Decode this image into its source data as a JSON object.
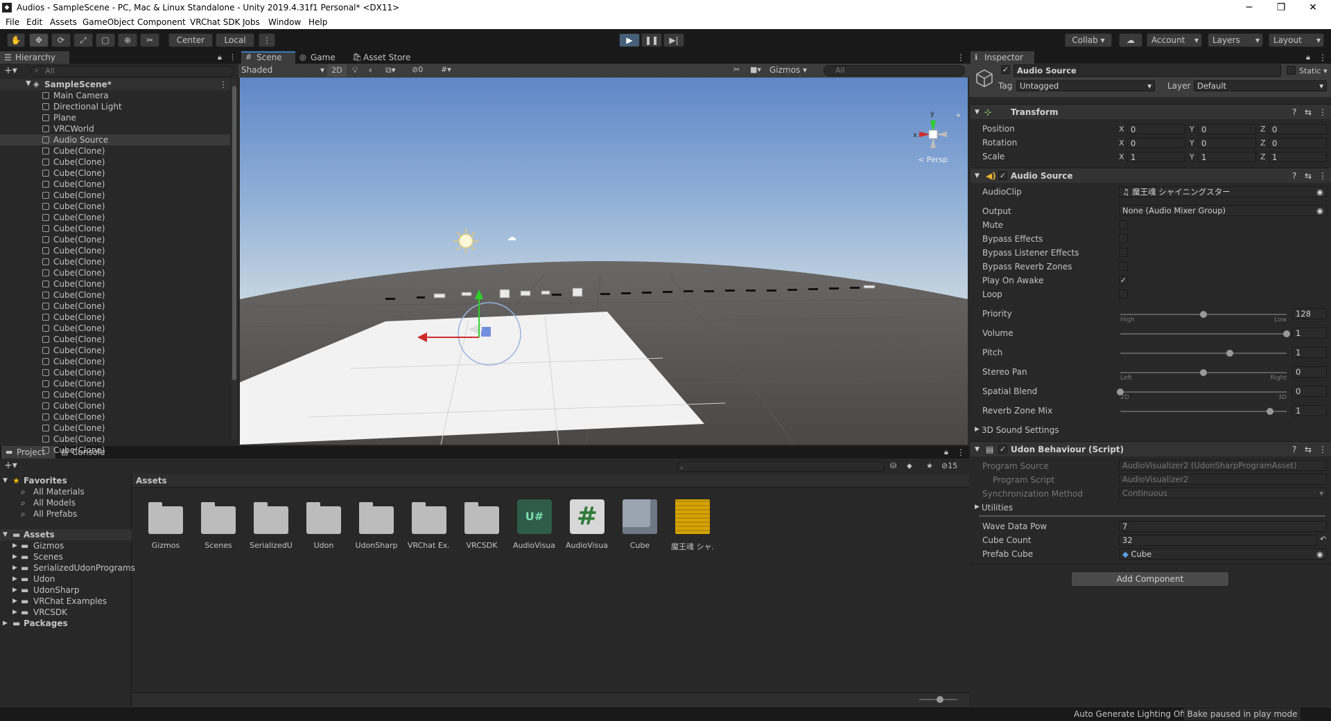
{
  "window": {
    "title": "Audios - SampleScene - PC, Mac & Linux Standalone - Unity 2019.4.31f1 Personal* <DX11>",
    "minimize": "─",
    "maximize": "❐",
    "close": "✕"
  },
  "menu": [
    "File",
    "Edit",
    "Assets",
    "GameObject",
    "Component",
    "VRChat SDK",
    "Jobs",
    "Window",
    "Help"
  ],
  "toolbar": {
    "center": "Center",
    "local": "Local",
    "collab": "Collab",
    "account": "Account",
    "layers": "Layers",
    "layout": "Layout"
  },
  "hierarchy": {
    "tab": "Hierarchy",
    "search_placeholder": "All",
    "scene": "SampleScene*",
    "items": [
      "Main Camera",
      "Directional Light",
      "Plane",
      "VRCWorld",
      "Audio Source",
      "Cube(Clone)",
      "Cube(Clone)",
      "Cube(Clone)",
      "Cube(Clone)",
      "Cube(Clone)",
      "Cube(Clone)",
      "Cube(Clone)",
      "Cube(Clone)",
      "Cube(Clone)",
      "Cube(Clone)",
      "Cube(Clone)",
      "Cube(Clone)",
      "Cube(Clone)",
      "Cube(Clone)",
      "Cube(Clone)",
      "Cube(Clone)",
      "Cube(Clone)",
      "Cube(Clone)",
      "Cube(Clone)",
      "Cube(Clone)",
      "Cube(Clone)",
      "Cube(Clone)",
      "Cube(Clone)",
      "Cube(Clone)",
      "Cube(Clone)",
      "Cube(Clone)",
      "Cube(Clone)",
      "Cube(Clone)"
    ],
    "selected": "Audio Source"
  },
  "scene": {
    "tabs": [
      "Scene",
      "Game",
      "Asset Store"
    ],
    "shading": "Shaded",
    "mode2d": "2D",
    "hidden_count": "0",
    "gizmos": "Gizmos",
    "search_placeholder": "All",
    "persp": "< Persp",
    "axis_x": "x",
    "axis_y": "y"
  },
  "project": {
    "tabs": [
      "Project",
      "Console"
    ],
    "breadcrumb": "Assets",
    "hidden_count": "15",
    "favorites": {
      "label": "Favorites",
      "items": [
        "All Materials",
        "All Models",
        "All Prefabs"
      ]
    },
    "assets": {
      "label": "Assets",
      "items": [
        "Gizmos",
        "Scenes",
        "SerializedUdonPrograms",
        "Udon",
        "UdonSharp",
        "VRChat Examples",
        "VRCSDK"
      ]
    },
    "packages": "Packages",
    "grid": [
      {
        "name": "Gizmos",
        "kind": "folder"
      },
      {
        "name": "Scenes",
        "kind": "folder"
      },
      {
        "name": "SerializedU...",
        "kind": "folder"
      },
      {
        "name": "Udon",
        "kind": "folder"
      },
      {
        "name": "UdonSharp",
        "kind": "folder"
      },
      {
        "name": "VRChat Ex...",
        "kind": "folder"
      },
      {
        "name": "VRCSDK",
        "kind": "folder"
      },
      {
        "name": "AudioVisual...",
        "kind": "udonsharp"
      },
      {
        "name": "AudioVisual...",
        "kind": "csharp"
      },
      {
        "name": "Cube",
        "kind": "prefab"
      },
      {
        "name": "魔王魂 シャ...",
        "kind": "audio"
      }
    ]
  },
  "inspector": {
    "tab": "Inspector",
    "object_name": "Audio Source",
    "static": "Static",
    "tag_label": "Tag",
    "tag": "Untagged",
    "layer_label": "Layer",
    "layer": "Default",
    "transform": {
      "title": "Transform",
      "position": {
        "label": "Position",
        "x": "0",
        "y": "0",
        "z": "0"
      },
      "rotation": {
        "label": "Rotation",
        "x": "0",
        "y": "0",
        "z": "0"
      },
      "scale": {
        "label": "Scale",
        "x": "1",
        "y": "1",
        "z": "1"
      }
    },
    "audio": {
      "title": "Audio Source",
      "clip_label": "AudioClip",
      "clip": "♫ 魔王魂 シャイニングスター",
      "output_label": "Output",
      "output": "None (Audio Mixer Group)",
      "mute": "Mute",
      "bypass_effects": "Bypass Effects",
      "bypass_listener": "Bypass Listener Effects",
      "bypass_reverb": "Bypass Reverb Zones",
      "play_on_awake": "Play On Awake",
      "loop": "Loop",
      "check": "✓",
      "priority": {
        "label": "Priority",
        "value": "128",
        "pos": 0.5,
        "min_label": "High",
        "max_label": "Low"
      },
      "volume": {
        "label": "Volume",
        "value": "1",
        "pos": 1.0
      },
      "pitch": {
        "label": "Pitch",
        "value": "1",
        "pos": 0.66
      },
      "stereo_pan": {
        "label": "Stereo Pan",
        "value": "0",
        "pos": 0.5,
        "min_label": "Left",
        "max_label": "Right"
      },
      "spatial_blend": {
        "label": "Spatial Blend",
        "value": "0",
        "pos": 0.0,
        "min_label": "2D",
        "max_label": "3D"
      },
      "reverb_mix": {
        "label": "Reverb Zone Mix",
        "value": "1",
        "pos": 0.9
      },
      "sound3d": "3D Sound Settings"
    },
    "udon": {
      "title": "Udon Behaviour (Script)",
      "program_source_label": "Program Source",
      "program_source": "AudioVisualizer2 (UdonSharpProgramAsset)",
      "program_script_label": "Program Script",
      "program_script": "AudioVisualizer2",
      "sync_label": "Synchronization Method",
      "sync": "Continuous",
      "utilities": "Utilities",
      "wave_label": "Wave Data Pow",
      "wave": "7",
      "cube_count_label": "Cube Count",
      "cube_count": "32",
      "prefab_label": "Prefab Cube",
      "prefab": "Cube"
    },
    "add_component": "Add Component"
  },
  "status": {
    "lighting": "Auto Generate Lighting Off",
    "bake": "Bake paused in play mode"
  }
}
